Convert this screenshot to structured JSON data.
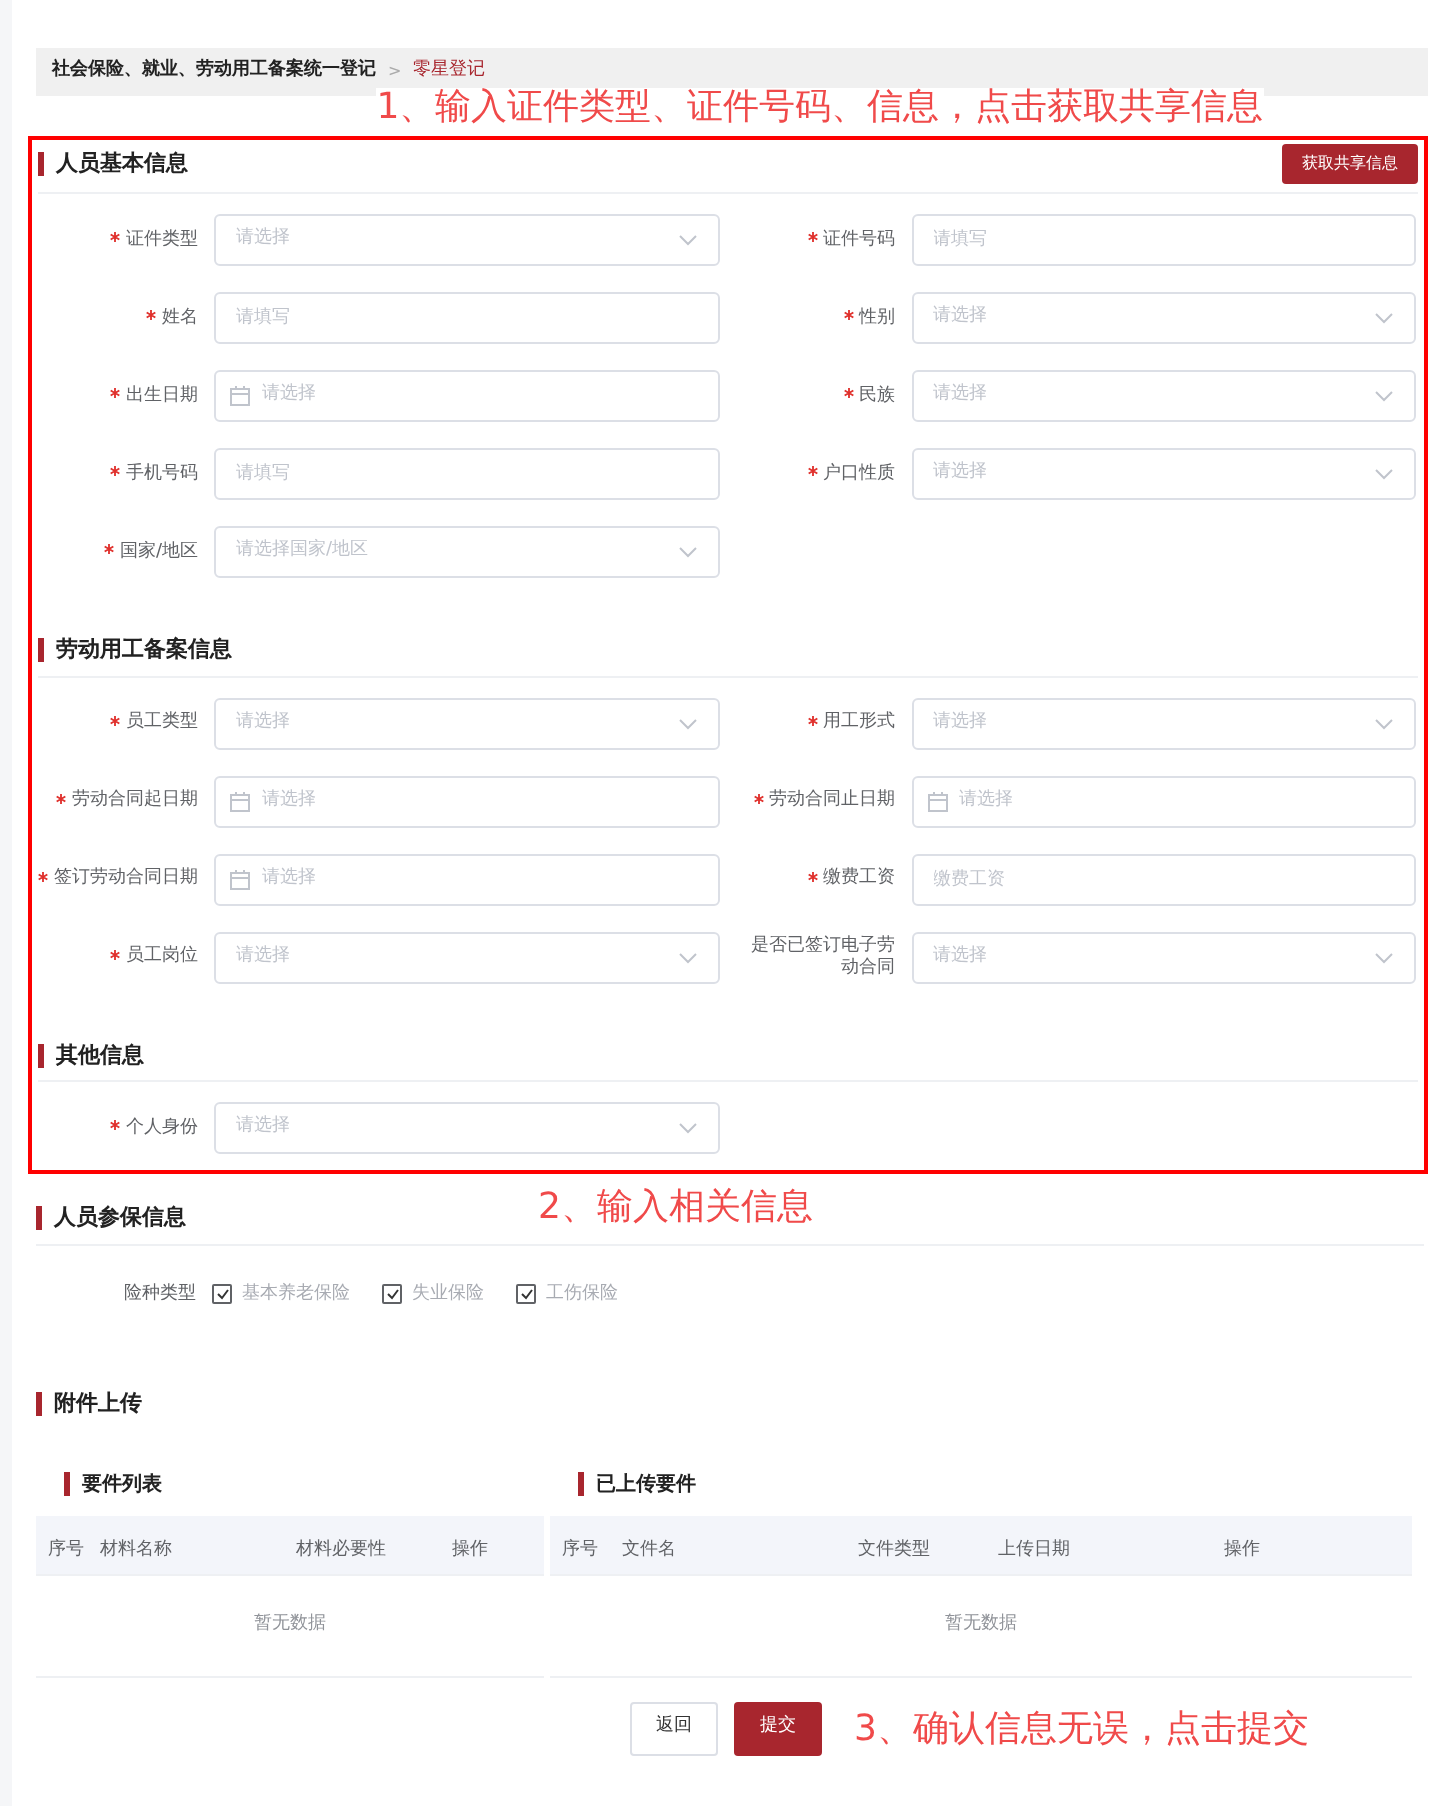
{
  "breadcrumb": [
    {
      "label": "社会保险、就业、劳动用工备案统一登记",
      "selected": false
    },
    {
      "label": "零星登记",
      "selected": true
    }
  ],
  "breadcrumb_separator": ">",
  "annotations": [
    "1、输入证件类型、证件号码、信息，点击获取共享信息",
    "2、输入相关信息",
    "3、确认信息无误，点击提交"
  ],
  "sections": [
    {
      "title": "人员基本信息",
      "action": "获取共享信息",
      "fields": [
        {
          "label": "证件类型",
          "required": true,
          "kind": "select",
          "placeholder": "请选择"
        },
        {
          "label": "证件号码",
          "required": true,
          "kind": "text",
          "placeholder": "请填写"
        },
        {
          "label": "姓名",
          "required": true,
          "kind": "text",
          "placeholder": "请填写"
        },
        {
          "label": "性别",
          "required": true,
          "kind": "select",
          "placeholder": "请选择"
        },
        {
          "label": "出生日期",
          "required": true,
          "kind": "date",
          "placeholder": "请选择"
        },
        {
          "label": "民族",
          "required": true,
          "kind": "select",
          "placeholder": "请选择"
        },
        {
          "label": "手机号码",
          "required": true,
          "kind": "text",
          "placeholder": "请填写"
        },
        {
          "label": "户口性质",
          "required": true,
          "kind": "select",
          "placeholder": "请选择"
        },
        {
          "label": "国家/地区",
          "required": true,
          "kind": "select",
          "placeholder": "请选择国家/地区"
        }
      ]
    },
    {
      "title": "劳动用工备案信息",
      "fields": [
        {
          "label": "员工类型",
          "required": true,
          "kind": "select",
          "placeholder": "请选择"
        },
        {
          "label": "用工形式",
          "required": true,
          "kind": "select",
          "placeholder": "请选择"
        },
        {
          "label": "劳动合同起日期",
          "required": true,
          "kind": "date",
          "placeholder": "请选择"
        },
        {
          "label": "劳动合同止日期",
          "required": true,
          "kind": "date",
          "placeholder": "请选择"
        },
        {
          "label": "签订劳动合同日期",
          "required": true,
          "kind": "date",
          "placeholder": "请选择"
        },
        {
          "label": "缴费工资",
          "required": true,
          "kind": "text",
          "placeholder": "缴费工资"
        },
        {
          "label": "员工岗位",
          "required": true,
          "kind": "select",
          "placeholder": "请选择"
        },
        {
          "label": "是否已签订电子劳动合同",
          "required": false,
          "kind": "select",
          "placeholder": "请选择"
        }
      ]
    },
    {
      "title": "其他信息",
      "fields": [
        {
          "label": "个人身份",
          "required": true,
          "kind": "select",
          "placeholder": "请选择"
        }
      ]
    }
  ],
  "insurance": {
    "title": "人员参保信息",
    "label": "险种类型",
    "options": [
      {
        "label": "基本养老保险",
        "checked": true
      },
      {
        "label": "失业保险",
        "checked": true
      },
      {
        "label": "工伤保险",
        "checked": true
      }
    ]
  },
  "attachments": {
    "title": "附件上传",
    "required_list": {
      "title": "要件列表",
      "columns": [
        "序号",
        "材料名称",
        "材料必要性",
        "操作"
      ],
      "empty": "暂无数据"
    },
    "uploaded": {
      "title": "已上传要件",
      "columns": [
        "序号",
        "文件名",
        "文件类型",
        "上传日期",
        "操作"
      ],
      "empty": "暂无数据"
    }
  },
  "buttons": [
    {
      "label": "返回",
      "kind": "secondary"
    },
    {
      "label": "提交",
      "kind": "primary"
    }
  ]
}
